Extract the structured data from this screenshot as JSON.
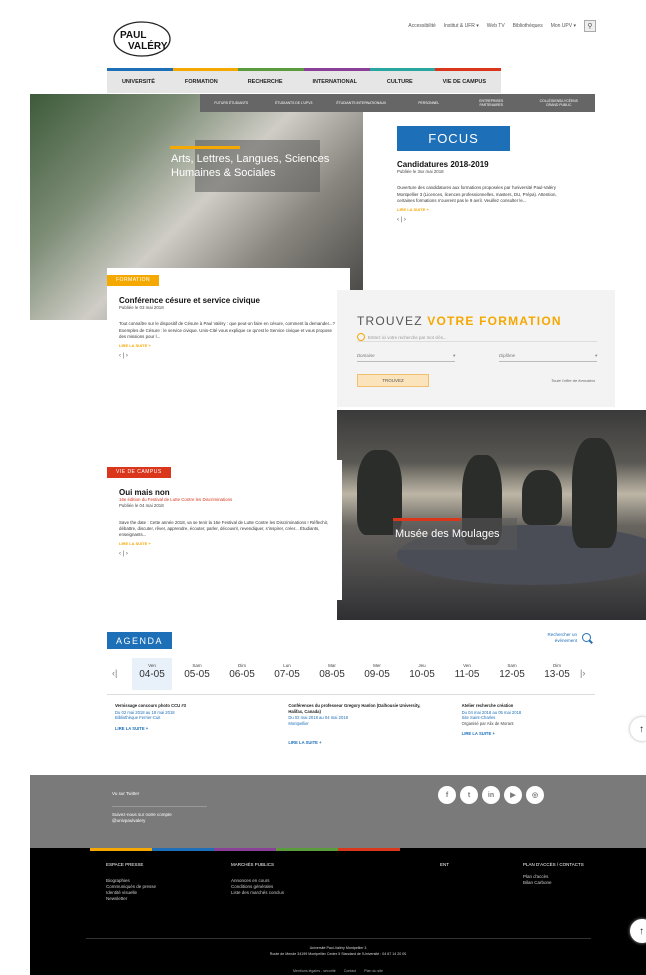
{
  "logo_text": "PAUL VALÉRY",
  "topnav": [
    "Accessibilité",
    "Institut & UFR ▾",
    "Web TV",
    "Bibliothèques",
    "Mon UPV ▾"
  ],
  "colors": {
    "blue": "#1d6fb8",
    "yellow": "#f4a800",
    "red": "#d9361b",
    "green": "#5a9b3c",
    "purple": "#8a3f98",
    "gray": "#7a7a7a"
  },
  "mainnav": [
    "UNIVERSITÉ",
    "FORMATION",
    "RECHERCHE",
    "INTERNATIONAL",
    "CULTURE",
    "VIE DE CAMPUS"
  ],
  "audience": [
    "FUTURS ÉTUDIANTS",
    "ÉTUDIANTS DE L'UPV3",
    "ÉTUDIANTS INTERNATIONAUX",
    "PERSONNEL",
    "ENTREPRISES PARTENAIRES",
    "COLLÉGIENS/LYCÉENS GRAND PUBLIC"
  ],
  "hero": {
    "title": "Arts, Lettres, Langues, Sciences Humaines & Sociales"
  },
  "focus": {
    "label": "FOCUS",
    "title": "Candidatures 2018-2019",
    "date": "Publiée le 3xx mai 2018",
    "text": "Ouverture des candidatures aux formations proposées par l'université Paul-Valéry Montpellier 3 (Licences, licences professionnelles, masters, DU, Prépa). Attention, certaines formations n'ouvrent pas le 9 avril. Veuillez consulter le...",
    "more": "LIRE LA SUITE  +",
    "pager": "‹ | ›"
  },
  "formation": {
    "tag": "FORMATION",
    "title": "Conférence césure et service civique",
    "date": "Publiée le 03 mai 2018",
    "text": "Tout connaître sur le dispositif de Césure à Paul Valéry : que peut-on faire en césure, comment la demander...? Exemples de Césure : le service civique. Unis-Cité vous explique ce qu'est le Service civique et vous propose des missions pour l...",
    "more": "LIRE LA SUITE  +",
    "pager": "‹ | ›"
  },
  "trouvez": {
    "title_a": "TROUVEZ ",
    "title_b": "VOTRE FORMATION",
    "placeholder": "Entrez ici votre recherche par mot clés...",
    "domaine": "Domaine",
    "diplome": "Diplôme",
    "button": "TROUVEZ",
    "link": "Toute l'offre de formation"
  },
  "musee": {
    "title": "Musée des Moulages"
  },
  "vie": {
    "tag": "VIE DE CAMPUS",
    "title": "Oui mais non",
    "subtitle": "16e édition du Festival de Lutte Contre les Discriminations",
    "date": "Publiée le 04 mai 2018",
    "text": "Save the date : Cette année 2018, va se tenir la 16e Festival de Lutte Contre les Discriminations ! Réflechir, débattre, discuter, rêver, apprendre, écouter, parler, découvrir, revendiquer, s'inspirer, créer... Étudiants, enseignants...",
    "more": "LIRE LA SUITE  +",
    "pager": "‹ | ›"
  },
  "agenda": {
    "label": "AGENDA",
    "search": "Rechercher un événement",
    "prev": "‹|",
    "next": "|›",
    "days": [
      {
        "n": "Ven",
        "d": "04-05"
      },
      {
        "n": "Sam",
        "d": "05-05"
      },
      {
        "n": "Dim",
        "d": "06-05"
      },
      {
        "n": "Lun",
        "d": "07-05"
      },
      {
        "n": "Mar",
        "d": "08-05"
      },
      {
        "n": "Mer",
        "d": "09-05"
      },
      {
        "n": "Jeu",
        "d": "10-05"
      },
      {
        "n": "Ven",
        "d": "11-05"
      },
      {
        "n": "Sam",
        "d": "12-05"
      },
      {
        "n": "Dim",
        "d": "13-05"
      }
    ],
    "events": [
      {
        "title": "Vernissage concours photo CCU #3",
        "dates": "Du 02 mai 2018 au 18 mai 2018",
        "place": "Bibliothèque Ferrier-Cuit",
        "org": "",
        "more": "LIRE LA SUITE  +"
      },
      {
        "title": "Conférences du professeur Gregory Hanlon (Dalhousie University, Halifax, Canada)",
        "dates": "Du 02 mai 2018 au 04 mai 2018",
        "place": "Montpellier",
        "org": "",
        "more": "LIRE LA SUITE  +"
      },
      {
        "title": "Atelier recherche création",
        "dates": "Du 04 mai 2018 au 05 mai 2018",
        "place": "Site Saint-Charles",
        "org": "Organisé par Alix de Morant",
        "more": "LIRE LA SUITE  +"
      }
    ]
  },
  "twitter": {
    "title": "Vu sur Twitter",
    "follow": "Suivez-nous sur notre compte",
    "handle": "@univpaulvalery"
  },
  "socials": [
    "f",
    "t",
    "in",
    "▶",
    "◎"
  ],
  "footer": {
    "cols": [
      {
        "h": "ESPACE PRESSE",
        "items": [
          "Biographies",
          "Communiqués de presse",
          "Identité visuelle",
          "Newsletter"
        ]
      },
      {
        "h": "MARCHÉS PUBLICS",
        "items": [
          "Annonces en cours",
          "Conditions générales",
          "Liste des marchés conclus"
        ]
      },
      {
        "h": "ENT",
        "items": []
      },
      {
        "h": "PLAN D'ACCÈS / CONTACTS",
        "items": [
          "Plan d'accès",
          "Bilan Carbone"
        ]
      }
    ],
    "addr1": "Université Paul-Valéry Montpellier 3",
    "addr2": "Route de Mende 34199 Montpellier Cedex 5 Standard de l'Université : 04 67 14 20 00",
    "legal": [
      "Mentions légales - sécurité",
      "Contact",
      "Plan du site"
    ]
  }
}
